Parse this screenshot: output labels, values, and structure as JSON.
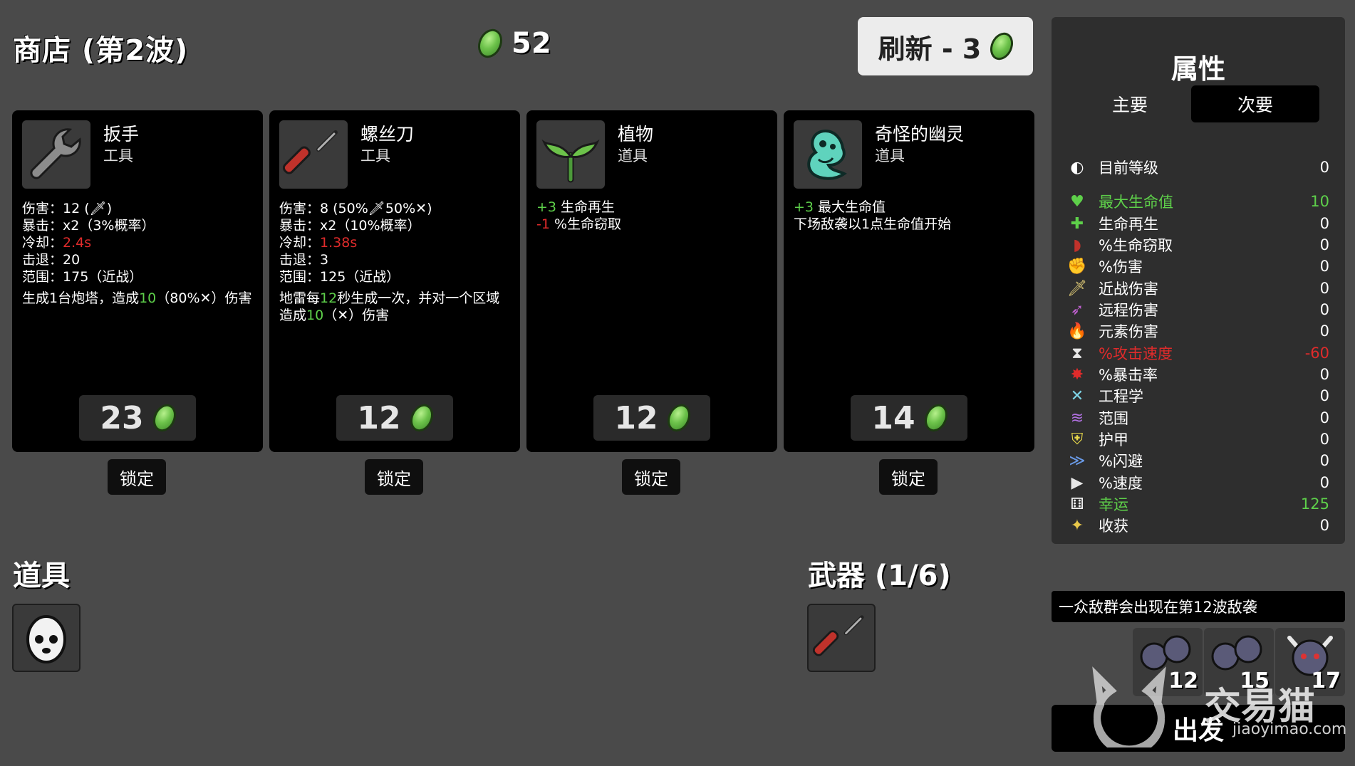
{
  "header": {
    "shop_title": "商店 (第2波)",
    "money": "52",
    "refresh_label": "刷新 - 3"
  },
  "cards": [
    {
      "name": "扳手",
      "type": "工具",
      "stats": [
        {
          "k": "伤害：",
          "v": "12 (",
          "v2": ")"
        },
        {
          "k": "暴击：",
          "v": "x2（3%概率）"
        },
        {
          "k": "冷却：",
          "v": "2.4s",
          "red": true
        },
        {
          "k": "击退：",
          "v": "20"
        },
        {
          "k": "范围：",
          "v": "175（近战）"
        }
      ],
      "desc_a": "生成1台炮塔，造成",
      "desc_num": "10",
      "desc_b": "（80%",
      "desc_c": "）伤害",
      "price": "23",
      "lock": "锁定"
    },
    {
      "name": "螺丝刀",
      "type": "工具",
      "stats": [
        {
          "k": "伤害：",
          "v": "8 (50%",
          "v2": "50%",
          "v3": ")"
        },
        {
          "k": "暴击：",
          "v": "x2（10%概率）"
        },
        {
          "k": "冷却：",
          "v": "1.38s",
          "red": true
        },
        {
          "k": "击退：",
          "v": "3"
        },
        {
          "k": "范围：",
          "v": "125（近战）"
        }
      ],
      "desc_a": "地雷每",
      "desc_num": "12",
      "desc_b": "秒生成一次，并对一个区域造成",
      "desc_num2": "10",
      "desc_c": "（",
      "desc_d": "）伤害",
      "price": "12",
      "lock": "锁定"
    },
    {
      "name": "植物",
      "type": "道具",
      "lines": [
        {
          "sign": "+3",
          "color": "green",
          "text": " 生命再生"
        },
        {
          "sign": "-1",
          "color": "red",
          "text": " %生命窃取"
        }
      ],
      "price": "12",
      "lock": "锁定"
    },
    {
      "name": "奇怪的幽灵",
      "type": "道具",
      "lines": [
        {
          "sign": "+3",
          "color": "green",
          "text": " 最大生命值"
        },
        {
          "sign": "",
          "color": "",
          "text": "下场敌袭以1点生命值开始"
        }
      ],
      "price": "14",
      "lock": "锁定"
    }
  ],
  "items_section": {
    "title": "道具"
  },
  "weapons_section": {
    "title": "武器 (1/6)"
  },
  "stats_panel": {
    "title": "属性",
    "tab_primary": "主要",
    "tab_secondary": "次要",
    "rows": [
      {
        "icon": "level-icon",
        "label": "目前等级",
        "value": "0"
      },
      {
        "icon": "heart-icon",
        "label": "最大生命值",
        "value": "10",
        "color": "#5ed04a"
      },
      {
        "icon": "regen-icon",
        "label": "生命再生",
        "value": "0"
      },
      {
        "icon": "lifesteal-icon",
        "label": "%生命窃取",
        "value": "0"
      },
      {
        "icon": "damage-icon",
        "label": "%伤害",
        "value": "0"
      },
      {
        "icon": "melee-icon",
        "label": "近战伤害",
        "value": "0"
      },
      {
        "icon": "ranged-icon",
        "label": "远程伤害",
        "value": "0"
      },
      {
        "icon": "elemental-icon",
        "label": "元素伤害",
        "value": "0"
      },
      {
        "icon": "hourglass-icon",
        "label": "%攻击速度",
        "value": "-60",
        "color": "#e02b2b"
      },
      {
        "icon": "crit-icon",
        "label": "%暴击率",
        "value": "0"
      },
      {
        "icon": "engineering-icon",
        "label": "工程学",
        "value": "0"
      },
      {
        "icon": "range-icon",
        "label": "范围",
        "value": "0"
      },
      {
        "icon": "armor-icon",
        "label": "护甲",
        "value": "0"
      },
      {
        "icon": "dodge-icon",
        "label": "%闪避",
        "value": "0"
      },
      {
        "icon": "speed-icon",
        "label": "%速度",
        "value": "0"
      },
      {
        "icon": "luck-icon",
        "label": "幸运",
        "value": "125",
        "color": "#5ed04a"
      },
      {
        "icon": "harvest-icon",
        "label": "收获",
        "value": "0"
      }
    ]
  },
  "wave_info": {
    "banner": "一众敌群会出现在第12波敌袭",
    "enemies": [
      "12",
      "15",
      "17"
    ]
  },
  "go_button": "出发",
  "watermark": {
    "brand": "交易猫",
    "url": "jiaoyimao.com"
  },
  "colors": {
    "coin": "#6cc24a",
    "green": "#5ed04a",
    "red": "#e02b2b",
    "bg": "#4a4a4a"
  }
}
